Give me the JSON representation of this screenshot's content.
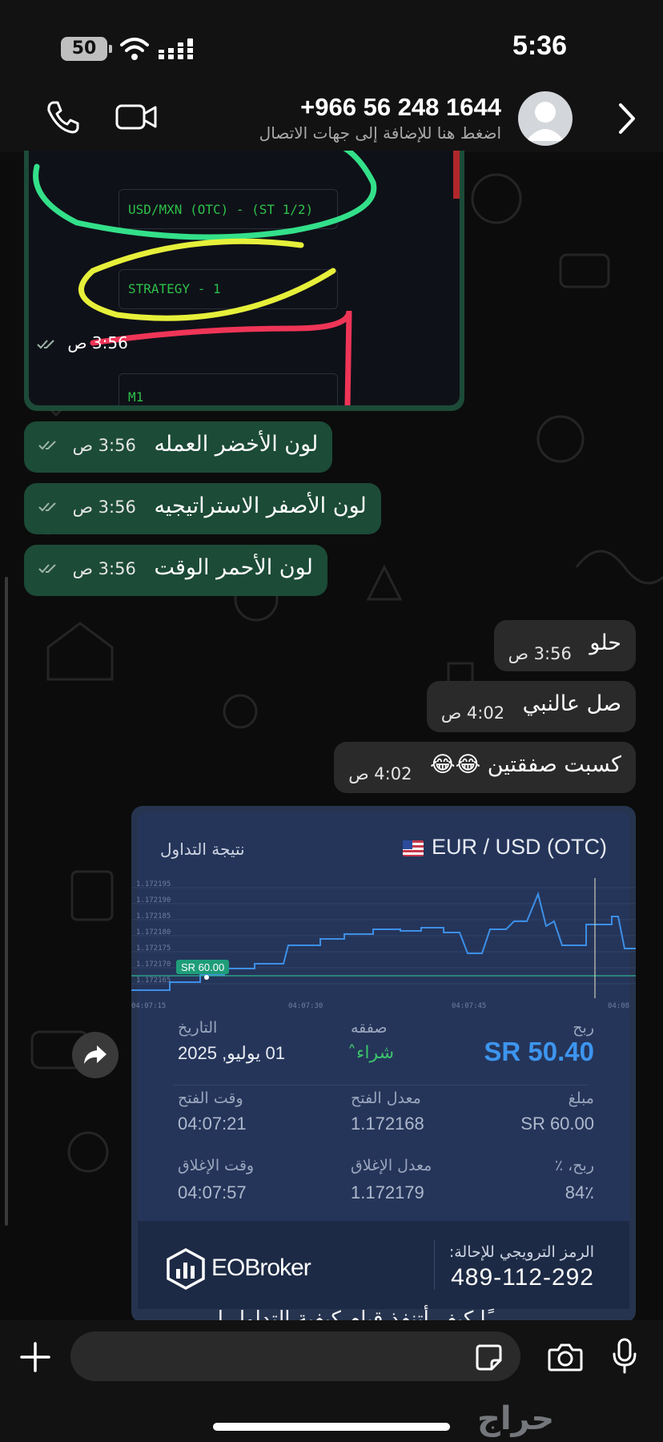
{
  "status": {
    "battery": "50",
    "time": "5:36"
  },
  "header": {
    "phone": "+966 56 248 1644",
    "subtitle": "اضغط هنا للإضافة إلى جهات الاتصال"
  },
  "image_message": {
    "lines": [
      "USD/MXN (OTC) - (ST 1/2)",
      "STRATEGY - 1",
      "M1"
    ],
    "time": "3:56 ص"
  },
  "messages": [
    {
      "text": "لون الأخضر العمله",
      "time": "3:56 ص",
      "dir": "in"
    },
    {
      "text": "لون الأصفر الاستراتيجيه",
      "time": "3:56 ص",
      "dir": "in"
    },
    {
      "text": "لون الأحمر الوقت",
      "time": "3:56 ص",
      "dir": "in"
    },
    {
      "text": "حلو",
      "time": "3:56 ص",
      "dir": "out"
    },
    {
      "text": "صل عالنبي",
      "time": "4:02 ص",
      "dir": "out"
    },
    {
      "text": "كسبت صفقتين 😂😂",
      "time": "4:02 ص",
      "dir": "out"
    }
  ],
  "trade_card": {
    "pair": "EUR / USD (OTC)",
    "result_title": "نتيجة التداول",
    "chart_tag": "SR 60.00",
    "profit_label": "ربح",
    "profit_value": "SR 50.40",
    "deal_label": "صفقه",
    "deal_value": "شراء",
    "date_label": "التاريخ",
    "date_value": "01 يوليو, 2025",
    "amount_label": "مبلغ",
    "amount_value": "SR 60.00",
    "open_rate_label": "معدل الفتح",
    "open_rate_value": "1.172168",
    "open_time_label": "وقت الفتح",
    "open_time_value": "04:07:21",
    "profit_pct_label": "ربح، ٪",
    "profit_pct_value": "84٪",
    "close_rate_label": "معدل الإغلاق",
    "close_rate_value": "1.172179",
    "close_time_label": "وقت الإغلاق",
    "close_time_value": "04:07:57",
    "promo_label": "الرمز الترويجي للإحالة:",
    "promo_value": "489-112-292",
    "brand": "EOBroker"
  },
  "cutoff_text": "ًا كيف أتنفذ قيام كيفية التداول ل",
  "watermark": "حراج",
  "colors": {
    "incoming": "#1c4b38",
    "outgoing": "#2a2a2a",
    "profit": "#3d95ee",
    "buy": "#3ac36b"
  }
}
